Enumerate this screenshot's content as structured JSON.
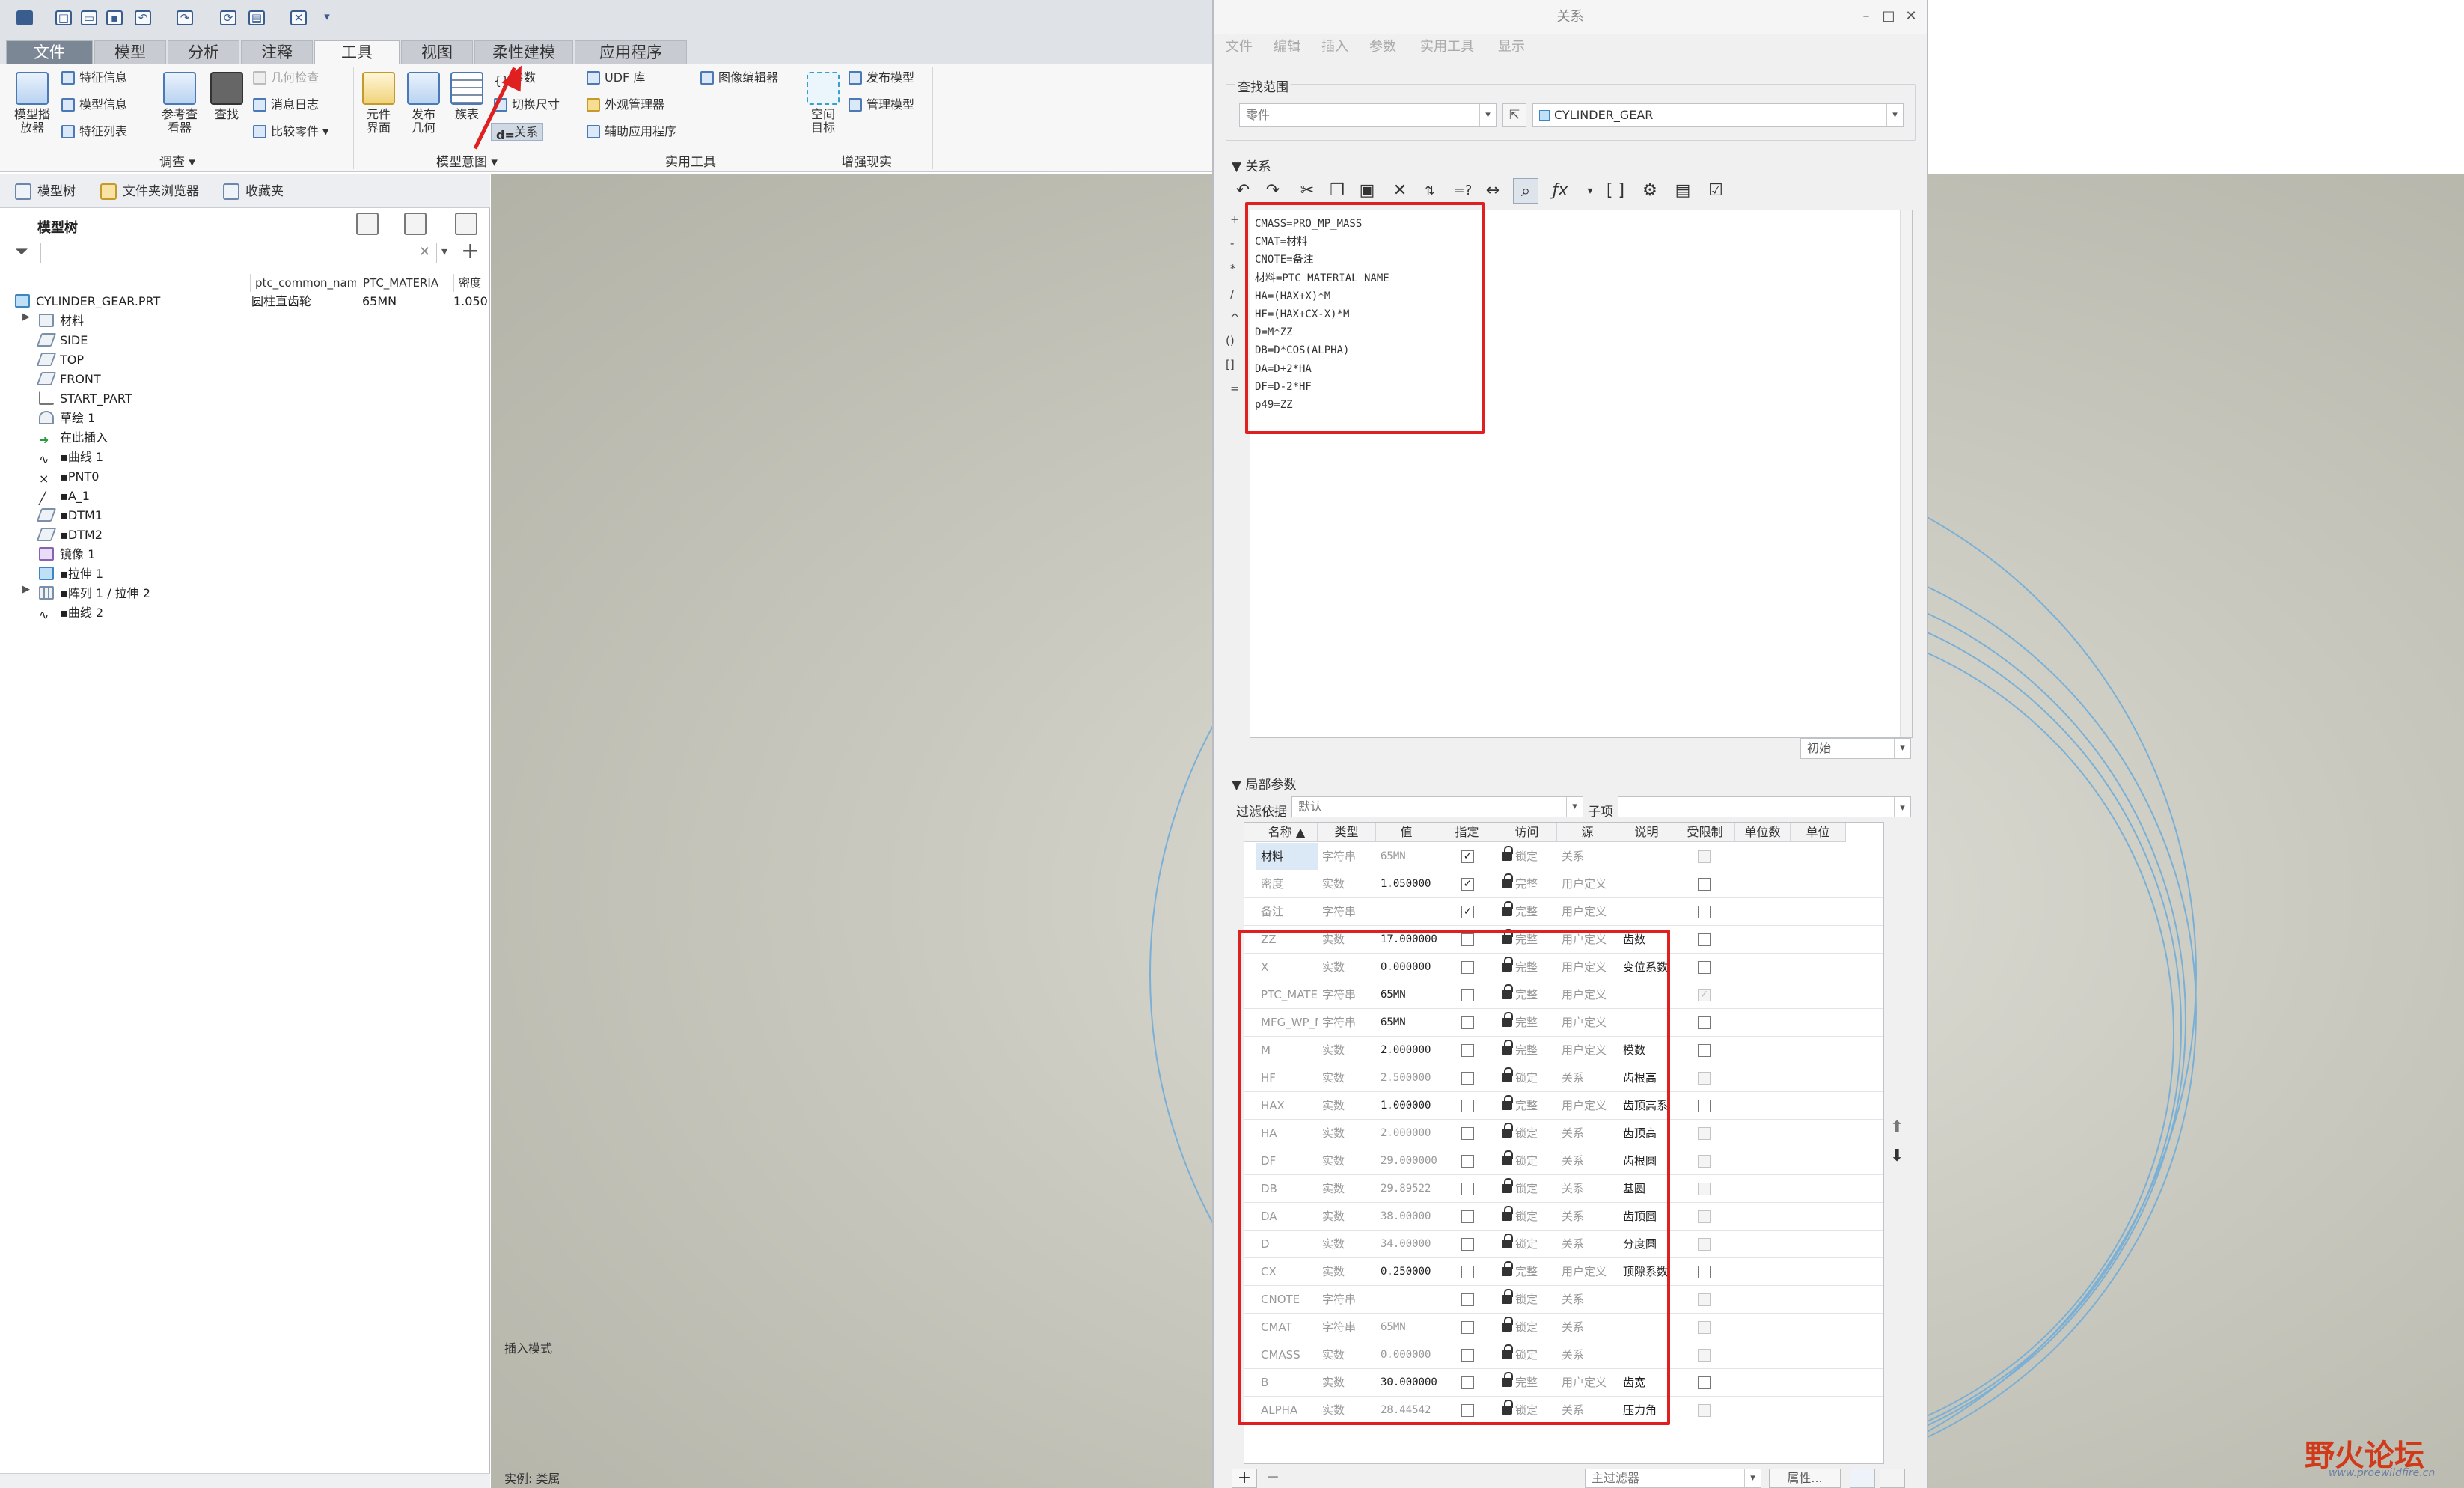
{
  "app": {
    "tabs": [
      "文件",
      "模型",
      "分析",
      "注释",
      "工具",
      "视图",
      "柔性建模",
      "应用程序"
    ],
    "active_tab": "工具"
  },
  "ribbon": {
    "investigate": {
      "label": "调查",
      "model_player": "模型播\n放器",
      "feature_info": "特征信息",
      "model_info": "模型信息",
      "feature_list": "特征列表",
      "ref_viewer": "参考查\n看器",
      "find": "查找",
      "geom_check": "几何检查",
      "message_log": "消息日志",
      "compare_part": "比较零件"
    },
    "model_intent": {
      "label": "模型意图",
      "component_interface": "元件\n界面",
      "publish_geom": "发布\n几何",
      "family_table": "族表",
      "params": "参数",
      "switch_dims": "切换尺寸",
      "relations": "关系"
    },
    "utilities": {
      "label": "实用工具",
      "udf_lib": "UDF 库",
      "appearance_mgr": "外观管理器",
      "aux_app": "辅助应用程序",
      "image_editor": "图像编辑器"
    },
    "ar": {
      "label": "增强现实",
      "space_target": "空间\n目标",
      "publish_model": "发布模型",
      "manage_model": "管理模型"
    }
  },
  "left_panel": {
    "nav_tabs": [
      "模型树",
      "文件夹浏览器",
      "收藏夹"
    ],
    "tree_title": "模型树",
    "columns": [
      "ptc_common_name",
      "PTC_MATERIA",
      "密度"
    ],
    "root": {
      "name": "CYLINDER_GEAR.PRT",
      "common_name": "圆柱直齿轮",
      "material": "65MN",
      "density": "1.050"
    },
    "items": [
      "材料",
      "SIDE",
      "TOP",
      "FRONT",
      "START_PART",
      "草绘 1",
      "在此插入",
      "曲线 1",
      "PNT0",
      "A_1",
      "DTM1",
      "DTM2",
      "镜像 1",
      "拉伸 1",
      "阵列 1 / 拉伸 2",
      "曲线 2"
    ]
  },
  "graphics": {
    "insert_mode": "插入模式",
    "instance": "实例: 类属"
  },
  "dialog": {
    "title": "关系",
    "menu": [
      "文件",
      "编辑",
      "插入",
      "参数",
      "实用工具",
      "显示"
    ],
    "lookup_label": "查找范围",
    "lookup_type": "零件",
    "lookup_object": "CYLINDER_GEAR",
    "relations_label": "关系",
    "relations": [
      "CMASS=PRO_MP_MASS",
      "CMAT=材料",
      "CNOTE=备注",
      "材料=PTC_MATERIAL_NAME",
      "HA=(HAX+X)*M",
      "HF=(HAX+CX-X)*M",
      "D=M*ZZ",
      "DB=D*COS(ALPHA)",
      "DA=D+2*HA",
      "DF=D-2*HF",
      "p49=ZZ"
    ],
    "gutter": [
      "+",
      "-",
      "*",
      "/",
      "^",
      "()",
      "[]",
      "="
    ],
    "initial": "初始",
    "local_params_label": "局部参数",
    "filter_label": "过滤依据",
    "filter_value": "默认",
    "child_label": "子项",
    "param_headers": [
      "名称 ▲",
      "类型",
      "值",
      "指定",
      "访问",
      "源",
      "说明",
      "受限制",
      "单位数",
      "单位"
    ],
    "params": [
      {
        "name": "材料",
        "type": "字符串",
        "value": "65MN",
        "assign": "✓",
        "access": "锁定",
        "source": "关系",
        "desc": "",
        "restricted": "dis"
      },
      {
        "name": "密度",
        "type": "实数",
        "value": "1.050000",
        "assign": "✓",
        "access": "完整",
        "source": "用户定义",
        "desc": "",
        "restricted": "on"
      },
      {
        "name": "备注",
        "type": "字符串",
        "value": "",
        "assign": "✓",
        "access": "完整",
        "source": "用户定义",
        "desc": "",
        "restricted": "on"
      },
      {
        "name": "ZZ",
        "type": "实数",
        "value": "17.000000",
        "assign": "",
        "access": "完整",
        "source": "用户定义",
        "desc": "齿数",
        "restricted": "on"
      },
      {
        "name": "X",
        "type": "实数",
        "value": "0.000000",
        "assign": "",
        "access": "完整",
        "source": "用户定义",
        "desc": "变位系数",
        "restricted": "on"
      },
      {
        "name": "PTC_MATE",
        "type": "字符串",
        "value": "65MN",
        "assign": "",
        "access": "完整",
        "source": "用户定义",
        "desc": "",
        "restricted": "checked"
      },
      {
        "name": "MFG_WP_M",
        "type": "字符串",
        "value": "65MN",
        "assign": "",
        "access": "完整",
        "source": "用户定义",
        "desc": "",
        "restricted": "on"
      },
      {
        "name": "M",
        "type": "实数",
        "value": "2.000000",
        "assign": "",
        "access": "完整",
        "source": "用户定义",
        "desc": "模数",
        "restricted": "on"
      },
      {
        "name": "HF",
        "type": "实数",
        "value": "2.500000",
        "assign": "",
        "access": "锁定",
        "source": "关系",
        "desc": "齿根高",
        "restricted": "dis"
      },
      {
        "name": "HAX",
        "type": "实数",
        "value": "1.000000",
        "assign": "",
        "access": "完整",
        "source": "用户定义",
        "desc": "齿顶高系",
        "restricted": "on"
      },
      {
        "name": "HA",
        "type": "实数",
        "value": "2.000000",
        "assign": "",
        "access": "锁定",
        "source": "关系",
        "desc": "齿顶高",
        "restricted": "dis"
      },
      {
        "name": "DF",
        "type": "实数",
        "value": "29.000000",
        "assign": "",
        "access": "锁定",
        "source": "关系",
        "desc": "齿根圆",
        "restricted": "dis"
      },
      {
        "name": "DB",
        "type": "实数",
        "value": "29.89522",
        "assign": "",
        "access": "锁定",
        "source": "关系",
        "desc": "基圆",
        "restricted": "dis"
      },
      {
        "name": "DA",
        "type": "实数",
        "value": "38.00000",
        "assign": "",
        "access": "锁定",
        "source": "关系",
        "desc": "齿顶圆",
        "restricted": "dis"
      },
      {
        "name": "D",
        "type": "实数",
        "value": "34.00000",
        "assign": "",
        "access": "锁定",
        "source": "关系",
        "desc": "分度圆",
        "restricted": "dis"
      },
      {
        "name": "CX",
        "type": "实数",
        "value": "0.250000",
        "assign": "",
        "access": "完整",
        "source": "用户定义",
        "desc": "顶隙系数",
        "restricted": "on"
      },
      {
        "name": "CNOTE",
        "type": "字符串",
        "value": "",
        "assign": "",
        "access": "锁定",
        "source": "关系",
        "desc": "",
        "restricted": "dis"
      },
      {
        "name": "CMAT",
        "type": "字符串",
        "value": "65MN",
        "assign": "",
        "access": "锁定",
        "source": "关系",
        "desc": "",
        "restricted": "dis"
      },
      {
        "name": "CMASS",
        "type": "实数",
        "value": "0.000000",
        "assign": "",
        "access": "锁定",
        "source": "关系",
        "desc": "",
        "restricted": "dis"
      },
      {
        "name": "B",
        "type": "实数",
        "value": "30.000000",
        "assign": "",
        "access": "完整",
        "source": "用户定义",
        "desc": "齿宽",
        "restricted": "on"
      },
      {
        "name": "ALPHA",
        "type": "实数",
        "value": "28.44542",
        "assign": "",
        "access": "锁定",
        "source": "关系",
        "desc": "压力角",
        "restricted": "dis"
      }
    ],
    "main_filter": "主过滤器",
    "properties": "属性..."
  },
  "watermark": {
    "text": "野火论坛",
    "url": "www.proewildfire.cn"
  },
  "colors": {
    "annotation": "#e02020",
    "accent": "#4a79b6"
  }
}
